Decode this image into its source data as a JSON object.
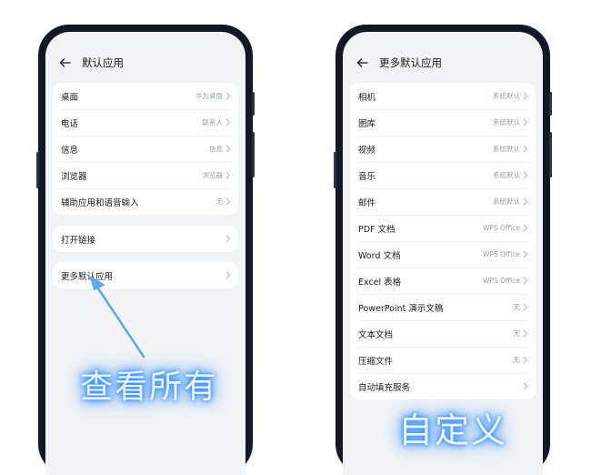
{
  "left_phone": {
    "title": "默认应用",
    "group1": [
      {
        "label": "桌面",
        "value": "华为桌面"
      },
      {
        "label": "电话",
        "value": "联系人"
      },
      {
        "label": "信息",
        "value": "信息"
      },
      {
        "label": "浏览器",
        "value": "浏览器"
      },
      {
        "label": "辅助应用和语音输入",
        "value": "无"
      }
    ],
    "group2": [
      {
        "label": "打开链接"
      }
    ],
    "group3": [
      {
        "label": "更多默认应用"
      }
    ]
  },
  "right_phone": {
    "title": "更多默认应用",
    "items": [
      {
        "label": "相机",
        "value": "系统默认"
      },
      {
        "label": "图库",
        "value": "系统默认"
      },
      {
        "label": "视频",
        "value": "系统默认"
      },
      {
        "label": "音乐",
        "value": "系统默认"
      },
      {
        "label": "邮件",
        "value": "系统默认"
      },
      {
        "label": "PDF 文档",
        "value": "WPS Office"
      },
      {
        "label": "Word 文档",
        "value": "WPS Office"
      },
      {
        "label": "Excel 表格",
        "value": "WPS Office"
      },
      {
        "label": "PowerPoint 演示文稿",
        "value": "无"
      },
      {
        "label": "文本文档",
        "value": "无"
      },
      {
        "label": "压缩文件",
        "value": "无"
      },
      {
        "label": "自动填充服务"
      }
    ]
  },
  "annotations": {
    "view_all": "查看所有",
    "customize": "自定义"
  },
  "colors": {
    "phone_frame": "#121826",
    "screen_bg": "#f1f3f5",
    "card_bg": "#ffffff",
    "arrow": "#5fa8ec",
    "glow": "#2e8cff"
  },
  "icons": {
    "back": "arrow-left-icon",
    "row_chevron": "chevron-right-icon"
  }
}
